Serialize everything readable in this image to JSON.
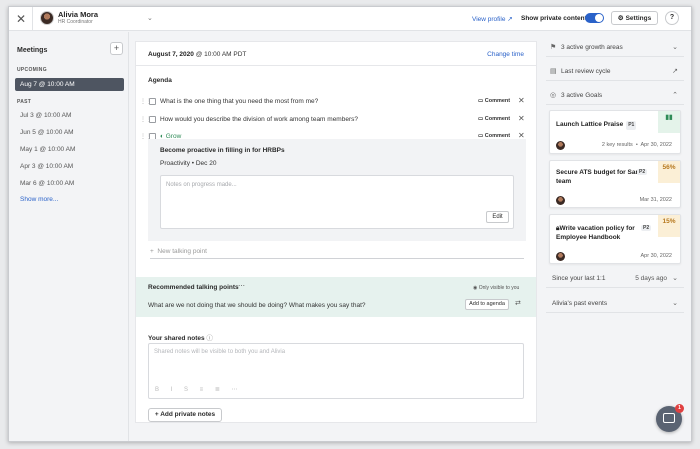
{
  "header": {
    "user_name": "Alivia Mora",
    "user_role": "HR Coordinator",
    "view_profile": "View profile",
    "show_private_label": "Show private content",
    "show_private_on": true,
    "settings_label": "Settings",
    "help_label": "?"
  },
  "sidebar": {
    "title": "Meetings",
    "upcoming_label": "UPCOMING",
    "upcoming": [
      {
        "label": "Aug 7 @ 10:00 AM",
        "active": true
      }
    ],
    "past_label": "PAST",
    "past": [
      "Jul 3 @ 10:00 AM",
      "Jun 5 @ 10:00 AM",
      "May 1 @ 10:00 AM",
      "Apr 3 @ 10:00 AM",
      "Mar 6 @ 10:00 AM"
    ],
    "show_more": "Show more..."
  },
  "meeting": {
    "date": "August 7, 2020",
    "time": "@ 10:00 AM PDT",
    "change_time": "Change time",
    "agenda_label": "Agenda",
    "agenda_items": [
      {
        "text": "What is the one thing that you need the most from me?",
        "comment": "Comment"
      },
      {
        "text": "How would you describe the division of work among team members?",
        "comment": "Comment"
      },
      {
        "text": "Grow",
        "comment": "Comment"
      }
    ],
    "goal_title": "Become proactive in filling in for HRBPs",
    "goal_meta": "Proactivity • Dec 20",
    "notes_placeholder": "Notes on progress made...",
    "edit_label": "Edit",
    "new_talking_point": "New talking point",
    "recommended": {
      "title": "Recommended talking points",
      "visibility": "Only visible to you",
      "question": "What are we not doing that we should be doing? What makes you say that?",
      "add_label": "Add to agenda"
    },
    "shared_notes_title": "Your shared notes",
    "shared_notes_placeholder": "Shared notes will be visible to both you and Alivia",
    "add_private_notes": "Add private notes"
  },
  "right_panel": {
    "growth_areas": "3 active growth areas",
    "review_cycle": "Last review cycle",
    "goals_header": "3 active Goals",
    "goals": [
      {
        "title": "Launch Lattice Praise",
        "priority": "P1",
        "meta": "2 key results",
        "date": "Apr 30, 2022",
        "corner": "",
        "corner_color": "#e4f3ea"
      },
      {
        "title": "Secure ATS budget for Sara's team",
        "priority": "P2",
        "meta": "",
        "date": "Mar 31, 2022",
        "corner": "56%",
        "corner_color": "#fbefd6"
      },
      {
        "title": "Write vacation policy for Employee Handbook",
        "priority": "P2",
        "meta": "",
        "date": "Apr 30, 2022",
        "corner": "15%",
        "corner_color": "#fbefd6"
      }
    ],
    "since_last": "Since your last 1:1",
    "since_ago": "5 days ago",
    "past_events": "Alivia's past events"
  },
  "chat": {
    "badge": "1"
  },
  "colors": {
    "accent": "#2a62c9",
    "active_meeting": "#4e5561",
    "recommended_bg": "#e6f2ee",
    "grow": "#2e8b57"
  }
}
